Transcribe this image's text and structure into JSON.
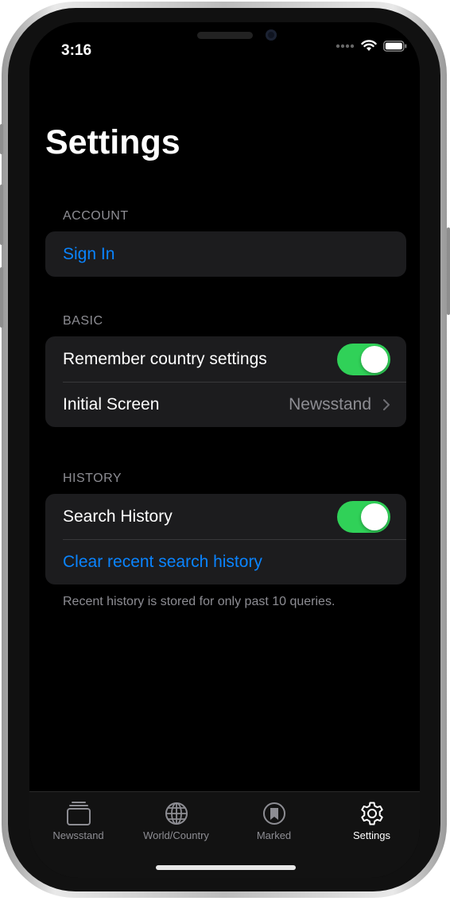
{
  "status_bar": {
    "time": "3:16"
  },
  "page": {
    "title": "Settings"
  },
  "sections": {
    "account": {
      "header": "ACCOUNT",
      "sign_in_label": "Sign In"
    },
    "basic": {
      "header": "BASIC",
      "remember_country_label": "Remember country settings",
      "remember_country_on": true,
      "initial_screen_label": "Initial Screen",
      "initial_screen_value": "Newsstand"
    },
    "history": {
      "header": "HISTORY",
      "search_history_label": "Search History",
      "search_history_on": true,
      "clear_label": "Clear recent search history",
      "footer": "Recent history is stored for only past 10 queries."
    }
  },
  "tabbar": {
    "tabs": [
      {
        "label": "Newsstand",
        "icon": "newsstand-icon",
        "active": false
      },
      {
        "label": "World/Country",
        "icon": "globe-icon",
        "active": false
      },
      {
        "label": "Marked",
        "icon": "bookmark-icon",
        "active": false
      },
      {
        "label": "Settings",
        "icon": "gear-icon",
        "active": true
      }
    ]
  },
  "colors": {
    "accent": "#0a84ff",
    "toggle_on": "#30d158",
    "background": "#000000",
    "group_background": "#1c1c1e",
    "secondary_text": "#8d8d93"
  }
}
